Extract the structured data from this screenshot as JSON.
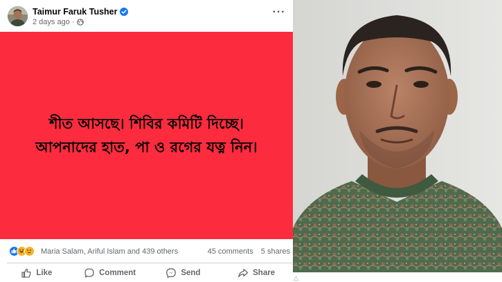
{
  "post": {
    "author": "Taimur Faruk Tusher",
    "verified": true,
    "timestamp": "2 days ago",
    "audience_icon": "globe-icon",
    "more_label": "···",
    "banner_color": "#fd2b3e",
    "banner_lines": [
      "শীত আসছে। শিবির কমিটি দিচ্ছে।",
      "আপনাদের হাত, পা ও রগের যত্ন নিন।"
    ],
    "reactions": {
      "icons": [
        "like",
        "haha",
        "sad"
      ],
      "names": "Maria Salam, Ariful Islam and 439 others",
      "comments": "45 comments",
      "shares": "5 shares"
    },
    "actions": [
      {
        "label": "Like",
        "icon": "thumbs-up-icon"
      },
      {
        "label": "Comment",
        "icon": "comment-icon"
      },
      {
        "label": "Send",
        "icon": "messenger-icon"
      },
      {
        "label": "Share",
        "icon": "share-icon"
      }
    ]
  },
  "colors": {
    "link_blue": "#1877f2",
    "muted_text": "#65676b"
  }
}
